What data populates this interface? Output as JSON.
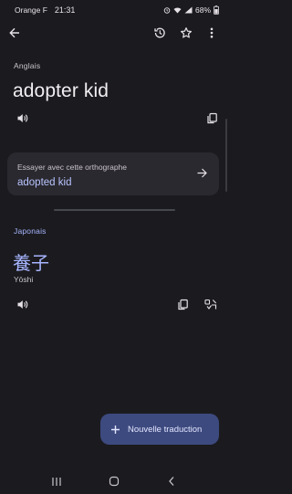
{
  "status_bar": {
    "carrier": "Orange F",
    "time": "21:31",
    "battery": "68%"
  },
  "app_bar": {
    "back_icon": "arrow-back-icon",
    "history_icon": "history-icon",
    "star_icon": "star-outline-icon",
    "more_icon": "more-vert-icon"
  },
  "source": {
    "language": "Anglais",
    "text": "adopter kid"
  },
  "suggestion": {
    "hint": "Essayer avec cette orthographe",
    "text": "adopted kid"
  },
  "target": {
    "language": "Japonais",
    "text": "養子",
    "romanization": "Yōshi"
  },
  "fab": {
    "label": "Nouvelle traduction"
  },
  "colors": {
    "background": "#1b1b1f",
    "accent": "#a7b5ff",
    "card": "#2a292f",
    "fab": "#3d4a7f"
  }
}
